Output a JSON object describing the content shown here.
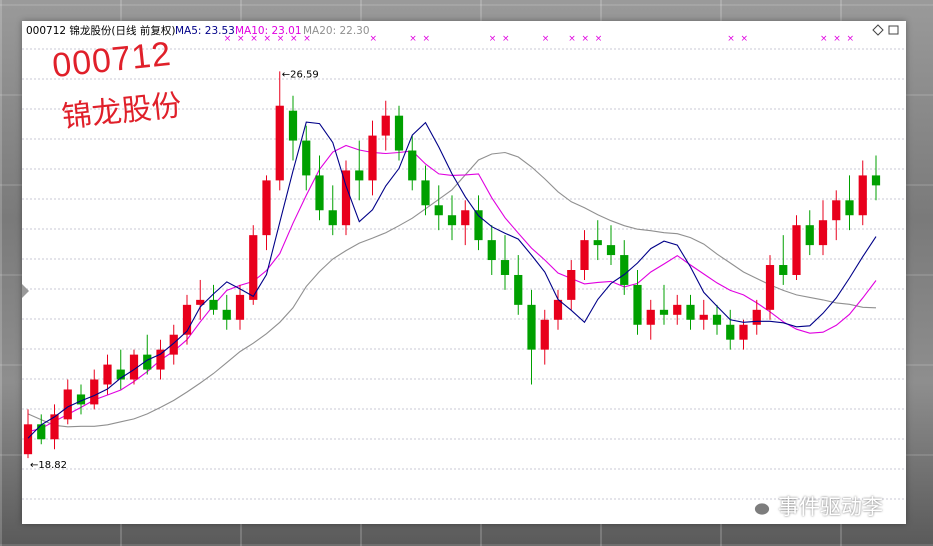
{
  "header": {
    "stock_label": "000712 锦龙股份(日线 前复权)",
    "ma5_label": "MA5: 23.53",
    "ma10_label": "MA10: 23.01",
    "ma20_label": "MA20: 22.30"
  },
  "stamp": {
    "code": "000712",
    "name": "锦龙股份"
  },
  "watermark": {
    "text": "事件驱动李",
    "icon": "wechat-icon"
  },
  "colors": {
    "up": "#e8001c",
    "down": "#00a000",
    "ma5": "#000088",
    "ma10": "#e000e0",
    "ma20": "#909090",
    "grid": "#b8b8c8"
  },
  "chart_data": {
    "type": "candlestick",
    "ylim": [
      18.0,
      27.2
    ],
    "annotations": [
      {
        "label": "26.59",
        "type": "high",
        "index": 19
      },
      {
        "label": "18.82",
        "type": "low",
        "index": 0
      }
    ],
    "series": [
      {
        "name": "MA5",
        "values": [
          19.22,
          19.49,
          19.65,
          19.85,
          19.97,
          20.08,
          20.21,
          20.43,
          20.6,
          20.79,
          20.91,
          21.13,
          21.37,
          21.86,
          22.12,
          22.36,
          22.22,
          22.07,
          22.51,
          23.56,
          24.59,
          25.57,
          25.54,
          25.16,
          24.29,
          23.57,
          23.81,
          24.29,
          24.64,
          25.31,
          25.56,
          25.07,
          24.53,
          24.07,
          23.69,
          23.47,
          23.34,
          23.22,
          22.9,
          22.56,
          22.01,
          21.79,
          21.55,
          22.01,
          22.33,
          22.51,
          22.74,
          23.03,
          23.18,
          23.1,
          22.66,
          22.15,
          21.87,
          21.6,
          21.55,
          21.57,
          21.57,
          21.54,
          21.46,
          21.48,
          21.73,
          22.04,
          22.44,
          22.87,
          23.27
        ]
      },
      {
        "name": "MA10",
        "values": [
          19.35,
          19.42,
          19.56,
          19.7,
          19.84,
          19.99,
          20.09,
          20.19,
          20.36,
          20.56,
          20.79,
          20.97,
          21.2,
          21.56,
          21.89,
          22.19,
          22.29,
          22.37,
          22.59,
          22.93,
          23.54,
          24.1,
          24.62,
          24.97,
          25.1,
          25.01,
          24.96,
          24.94,
          24.96,
          24.99,
          24.73,
          24.53,
          24.5,
          24.51,
          24.53,
          24.05,
          23.65,
          23.34,
          23.04,
          22.8,
          22.54,
          22.43,
          22.32,
          22.35,
          22.37,
          22.26,
          22.33,
          22.56,
          22.72,
          22.89,
          22.7,
          22.52,
          22.34,
          22.19,
          22.1,
          21.94,
          21.76,
          21.56,
          21.41,
          21.33,
          21.35,
          21.49,
          21.71,
          22.04,
          22.39
        ]
      },
      {
        "name": "MA20",
        "values": [
          19.71,
          19.59,
          19.48,
          19.45,
          19.46,
          19.46,
          19.49,
          19.55,
          19.61,
          19.71,
          19.84,
          19.98,
          20.15,
          20.33,
          20.52,
          20.74,
          20.96,
          21.13,
          21.32,
          21.55,
          21.84,
          22.27,
          22.57,
          22.82,
          22.99,
          23.14,
          23.24,
          23.35,
          23.49,
          23.64,
          23.83,
          24.02,
          24.21,
          24.51,
          24.81,
          24.93,
          24.96,
          24.87,
          24.67,
          24.43,
          24.17,
          23.97,
          23.85,
          23.71,
          23.59,
          23.49,
          23.42,
          23.39,
          23.35,
          23.33,
          23.25,
          23.12,
          22.92,
          22.74,
          22.56,
          22.43,
          22.3,
          22.19,
          22.1,
          22.05,
          22.0,
          21.94,
          21.91,
          21.85,
          21.84
        ]
      }
    ],
    "candles": [
      {
        "o": 18.9,
        "h": 19.8,
        "l": 18.82,
        "c": 19.5
      },
      {
        "o": 19.5,
        "h": 19.7,
        "l": 19.1,
        "c": 19.2
      },
      {
        "o": 19.2,
        "h": 19.9,
        "l": 19.0,
        "c": 19.7
      },
      {
        "o": 19.6,
        "h": 20.4,
        "l": 19.5,
        "c": 20.2
      },
      {
        "o": 20.1,
        "h": 20.3,
        "l": 19.7,
        "c": 19.9
      },
      {
        "o": 19.9,
        "h": 20.6,
        "l": 19.8,
        "c": 20.4
      },
      {
        "o": 20.3,
        "h": 20.9,
        "l": 20.1,
        "c": 20.7
      },
      {
        "o": 20.6,
        "h": 21.0,
        "l": 20.2,
        "c": 20.4
      },
      {
        "o": 20.4,
        "h": 21.0,
        "l": 20.3,
        "c": 20.9
      },
      {
        "o": 20.9,
        "h": 21.3,
        "l": 20.5,
        "c": 20.6
      },
      {
        "o": 20.6,
        "h": 21.2,
        "l": 20.4,
        "c": 21.0
      },
      {
        "o": 20.9,
        "h": 21.5,
        "l": 20.7,
        "c": 21.3
      },
      {
        "o": 21.3,
        "h": 22.1,
        "l": 21.1,
        "c": 21.9
      },
      {
        "o": 21.9,
        "h": 22.4,
        "l": 21.6,
        "c": 22.0
      },
      {
        "o": 22.0,
        "h": 22.3,
        "l": 21.7,
        "c": 21.8
      },
      {
        "o": 21.8,
        "h": 22.1,
        "l": 21.4,
        "c": 21.6
      },
      {
        "o": 21.6,
        "h": 22.3,
        "l": 21.4,
        "c": 22.1
      },
      {
        "o": 22.0,
        "h": 23.5,
        "l": 21.9,
        "c": 23.3
      },
      {
        "o": 23.3,
        "h": 24.5,
        "l": 23.0,
        "c": 24.4
      },
      {
        "o": 24.4,
        "h": 26.59,
        "l": 24.2,
        "c": 25.9
      },
      {
        "o": 25.8,
        "h": 26.1,
        "l": 24.8,
        "c": 25.2
      },
      {
        "o": 25.2,
        "h": 25.5,
        "l": 24.2,
        "c": 24.5
      },
      {
        "o": 24.5,
        "h": 24.9,
        "l": 23.6,
        "c": 23.8
      },
      {
        "o": 23.8,
        "h": 24.3,
        "l": 23.3,
        "c": 23.5
      },
      {
        "o": 23.5,
        "h": 24.8,
        "l": 23.3,
        "c": 24.6
      },
      {
        "o": 24.6,
        "h": 25.2,
        "l": 24.0,
        "c": 24.4
      },
      {
        "o": 24.4,
        "h": 25.6,
        "l": 24.1,
        "c": 25.3
      },
      {
        "o": 25.3,
        "h": 26.0,
        "l": 25.0,
        "c": 25.7
      },
      {
        "o": 25.7,
        "h": 25.9,
        "l": 24.8,
        "c": 25.0
      },
      {
        "o": 25.0,
        "h": 25.3,
        "l": 24.2,
        "c": 24.4
      },
      {
        "o": 24.4,
        "h": 24.7,
        "l": 23.7,
        "c": 23.9
      },
      {
        "o": 23.9,
        "h": 24.3,
        "l": 23.4,
        "c": 23.7
      },
      {
        "o": 23.7,
        "h": 24.1,
        "l": 23.2,
        "c": 23.5
      },
      {
        "o": 23.5,
        "h": 24.0,
        "l": 23.1,
        "c": 23.8
      },
      {
        "o": 23.8,
        "h": 24.1,
        "l": 23.0,
        "c": 23.2
      },
      {
        "o": 23.2,
        "h": 23.5,
        "l": 22.5,
        "c": 22.8
      },
      {
        "o": 22.8,
        "h": 23.3,
        "l": 22.2,
        "c": 22.5
      },
      {
        "o": 22.5,
        "h": 22.9,
        "l": 21.7,
        "c": 21.9
      },
      {
        "o": 21.9,
        "h": 22.2,
        "l": 20.3,
        "c": 21.0
      },
      {
        "o": 21.0,
        "h": 21.8,
        "l": 20.7,
        "c": 21.6
      },
      {
        "o": 21.6,
        "h": 22.2,
        "l": 21.4,
        "c": 22.0
      },
      {
        "o": 22.0,
        "h": 22.8,
        "l": 21.8,
        "c": 22.6
      },
      {
        "o": 22.6,
        "h": 23.4,
        "l": 22.4,
        "c": 23.2
      },
      {
        "o": 23.2,
        "h": 23.6,
        "l": 22.8,
        "c": 23.1
      },
      {
        "o": 23.1,
        "h": 23.5,
        "l": 22.7,
        "c": 22.9
      },
      {
        "o": 22.9,
        "h": 23.2,
        "l": 22.1,
        "c": 22.3
      },
      {
        "o": 22.3,
        "h": 22.6,
        "l": 21.3,
        "c": 21.5
      },
      {
        "o": 21.5,
        "h": 22.0,
        "l": 21.2,
        "c": 21.8
      },
      {
        "o": 21.8,
        "h": 22.3,
        "l": 21.5,
        "c": 21.7
      },
      {
        "o": 21.7,
        "h": 22.1,
        "l": 21.5,
        "c": 21.9
      },
      {
        "o": 21.9,
        "h": 22.1,
        "l": 21.4,
        "c": 21.6
      },
      {
        "o": 21.6,
        "h": 22.0,
        "l": 21.4,
        "c": 21.7
      },
      {
        "o": 21.7,
        "h": 21.9,
        "l": 21.3,
        "c": 21.5
      },
      {
        "o": 21.5,
        "h": 21.8,
        "l": 21.0,
        "c": 21.2
      },
      {
        "o": 21.2,
        "h": 21.6,
        "l": 21.0,
        "c": 21.5
      },
      {
        "o": 21.5,
        "h": 22.0,
        "l": 21.3,
        "c": 21.8
      },
      {
        "o": 21.8,
        "h": 22.9,
        "l": 21.6,
        "c": 22.7
      },
      {
        "o": 22.7,
        "h": 23.3,
        "l": 22.3,
        "c": 22.5
      },
      {
        "o": 22.5,
        "h": 23.7,
        "l": 22.4,
        "c": 23.5
      },
      {
        "o": 23.5,
        "h": 23.8,
        "l": 22.9,
        "c": 23.1
      },
      {
        "o": 23.1,
        "h": 24.0,
        "l": 22.9,
        "c": 23.6
      },
      {
        "o": 23.6,
        "h": 24.2,
        "l": 23.2,
        "c": 24.0
      },
      {
        "o": 24.0,
        "h": 24.5,
        "l": 23.4,
        "c": 23.7
      },
      {
        "o": 23.7,
        "h": 24.8,
        "l": 23.5,
        "c": 24.5
      },
      {
        "o": 24.5,
        "h": 24.9,
        "l": 24.0,
        "c": 24.3
      }
    ]
  }
}
